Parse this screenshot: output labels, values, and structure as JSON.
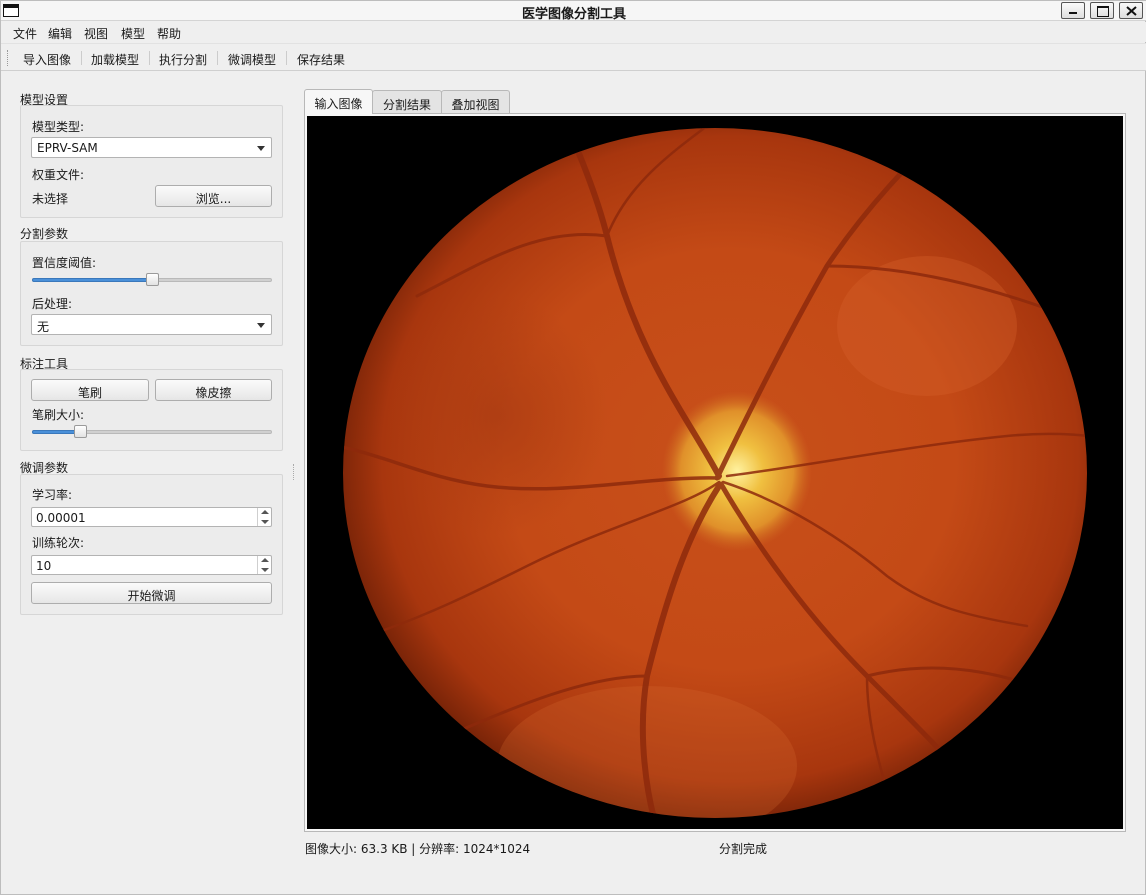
{
  "window": {
    "title": "医学图像分割工具"
  },
  "menu": [
    "文件",
    "编辑",
    "视图",
    "模型",
    "帮助"
  ],
  "toolbar": [
    "导入图像",
    "加载模型",
    "执行分割",
    "微调模型",
    "保存结果"
  ],
  "model_settings": {
    "title": "模型设置",
    "model_type_label": "模型类型:",
    "model_type_value": "EPRV-SAM",
    "weight_file_label": "权重文件:",
    "weight_file_value": "未选择",
    "browse_button": "浏览..."
  },
  "segmentation_params": {
    "title": "分割参数",
    "confidence_label": "置信度阈值:",
    "confidence_level": 0.5,
    "postprocess_label": "后处理:",
    "postprocess_value": "无"
  },
  "annotation_tools": {
    "title": "标注工具",
    "brush_button": "笔刷",
    "eraser_button": "橡皮擦",
    "brush_size_label": "笔刷大小:",
    "brush_size_level": 0.2
  },
  "finetune_params": {
    "title": "微调参数",
    "learning_rate_label": "学习率:",
    "learning_rate_value": "0.00001",
    "epochs_label": "训练轮次:",
    "epochs_value": "10",
    "start_button": "开始微调"
  },
  "tabs": [
    "输入图像",
    "分割结果",
    "叠加视图"
  ],
  "active_tab": 0,
  "status": {
    "image_info": "图像大小: 63.3 KB | 分辨率: 1024*1024",
    "message": "分割完成"
  },
  "colors": {
    "accent": "#4a90d9",
    "image_background": "#000000",
    "fundus_center": "#c8501a",
    "optic_disc": "#f0c040"
  },
  "icons": [
    "app-window-icon",
    "minimize-icon",
    "maximize-icon",
    "close-icon",
    "dropdown-arrow-icon",
    "spin-up-icon",
    "spin-down-icon"
  ]
}
